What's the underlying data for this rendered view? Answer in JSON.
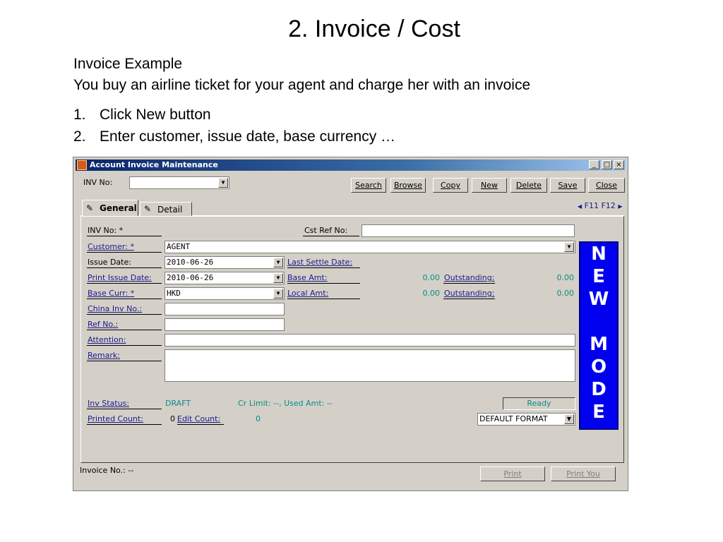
{
  "slide": {
    "title": "2. Invoice / Cost",
    "subtitle1": "Invoice Example",
    "subtitle2": "You buy an airline ticket for your agent and charge her with an invoice",
    "steps": [
      {
        "num": "1.",
        "text": "Click New button"
      },
      {
        "num": "2.",
        "text": "Enter customer, issue date, base currency …"
      }
    ]
  },
  "window": {
    "title": "Account Invoice Maintenance",
    "controls": [
      "_",
      "□",
      "×"
    ],
    "inv_no_label": "INV No:",
    "inv_no_value": "",
    "toolbar": {
      "search": "Search",
      "browse": "Browse",
      "copy": "Copy",
      "new": "New",
      "delete": "Delete",
      "save": "Save",
      "close": "Close"
    },
    "tabs": {
      "general": "General",
      "detail": "Detail",
      "nav": "F11 F12"
    },
    "form": {
      "inv_no_label": "INV No: *",
      "cst_ref_label": "Cst Ref No:",
      "cst_ref_value": "",
      "customer_label": "Customer: *",
      "customer_value": "AGENT",
      "issue_date_label": "Issue Date:",
      "issue_date_value": "2010-06-26",
      "last_settle_label": "Last Settle Date:",
      "print_issue_label": "Print Issue Date:",
      "print_issue_value": "2010-06-26",
      "base_amt_label": "Base Amt:",
      "base_amt_value": "0.00",
      "outstanding1_label": "Outstanding:",
      "outstanding1_value": "0.00",
      "base_curr_label": "Base Curr: *",
      "base_curr_value": "HKD",
      "local_amt_label": "Local Amt:",
      "local_amt_value": "0.00",
      "outstanding2_label": "Outstanding:",
      "outstanding2_value": "0.00",
      "china_inv_label": "China Inv No.:",
      "ref_no_label": "Ref No.:",
      "attention_label": "Attention:",
      "remark_label": "Remark:",
      "inv_status_label": "Inv Status:",
      "inv_status_value": "DRAFT",
      "cr_limit_text": "Cr Limit: --, Used Amt: --",
      "ready_label": "Ready",
      "printed_count_label": "Printed Count:",
      "printed_count_value": "0",
      "edit_count_label": "Edit Count:",
      "edit_count_value": "0",
      "format_value": "DEFAULT FORMAT"
    },
    "new_mode": [
      "N",
      "E",
      "W",
      "",
      "M",
      "O",
      "D",
      "E"
    ],
    "footer": {
      "invoice_no": "Invoice No.: --",
      "print": "Print",
      "print_you": "Print You"
    }
  }
}
